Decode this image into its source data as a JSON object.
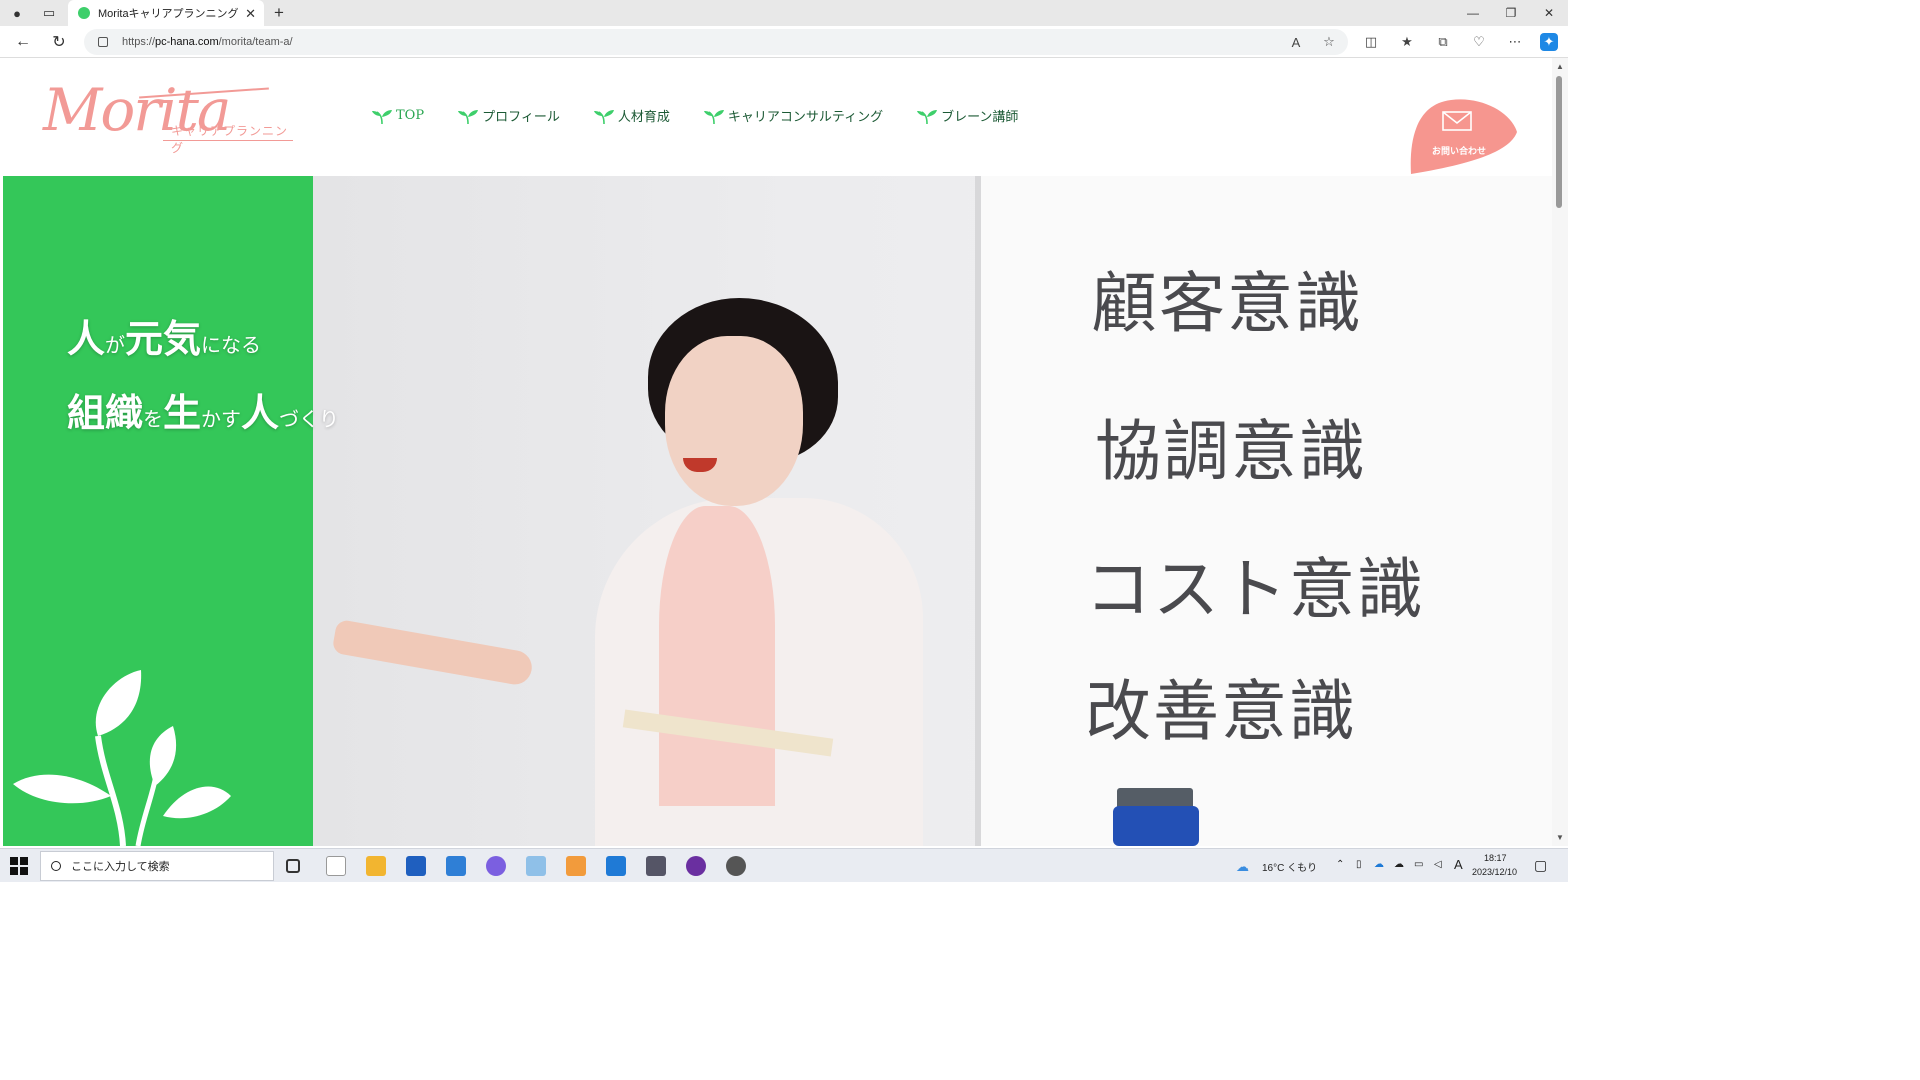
{
  "browser": {
    "tab_title": "Moritaキャリアプランニング",
    "url_prefix": "https://",
    "url_domain": "pc-hana.com",
    "url_path": "/morita/team-a/"
  },
  "site": {
    "logo_script": "Morita",
    "logo_sub": "キャリアプランニング",
    "nav": [
      {
        "label": "TOP"
      },
      {
        "label": "プロフィール"
      },
      {
        "label": "人材育成"
      },
      {
        "label": "キャリアコンサルティング"
      },
      {
        "label": "ブレーン講師"
      }
    ],
    "contact_label": "お問い合わせ",
    "colors": {
      "brand_green": "#34c759",
      "brand_pink": "#f6968f",
      "nav_text": "#1c5a35"
    }
  },
  "hero": {
    "line1": {
      "a": "人",
      "b": "が",
      "c": "元気",
      "d": "になる"
    },
    "line2": {
      "a": "組織",
      "b": "を",
      "c": "生",
      "d": "かす",
      "e": "人",
      "f": "づくり"
    },
    "board_words": [
      "顧客意識",
      "協調意識",
      "コスト意識",
      "改善意識"
    ]
  },
  "taskbar": {
    "search_placeholder": "ここに入力して検索",
    "weather": "16°C くもり",
    "ime": "A",
    "time": "18:17",
    "date": "2023/12/10"
  }
}
